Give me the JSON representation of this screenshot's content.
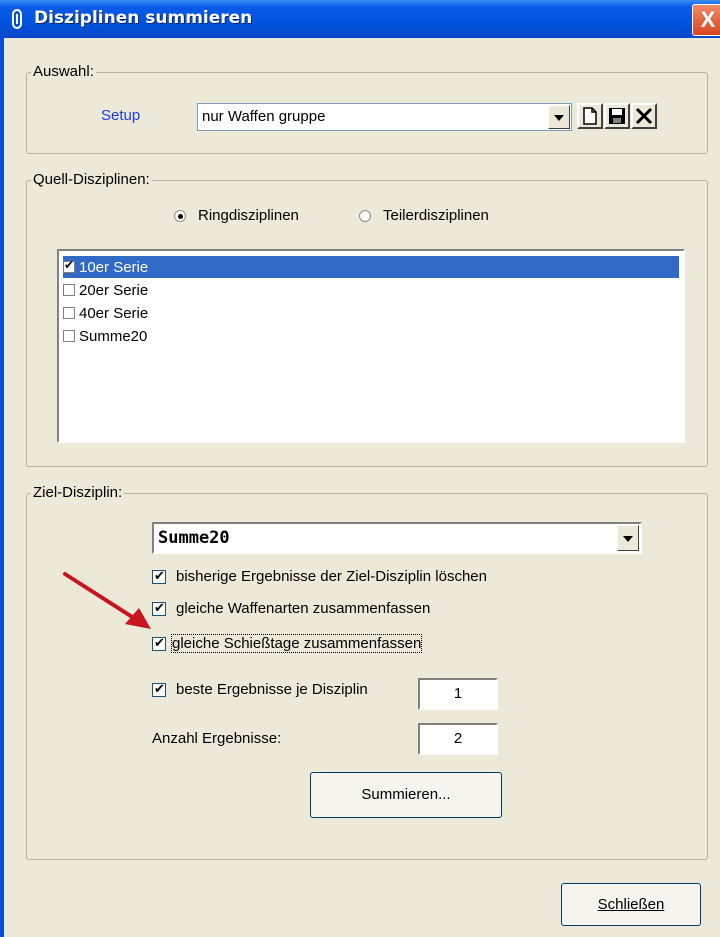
{
  "window": {
    "title": "Disziplinen summieren",
    "close_glyph": "X"
  },
  "auswahl": {
    "legend": "Auswahl:",
    "setup_label": "Setup",
    "setup_value": "nur Waffen gruppe",
    "icons": [
      "new-document-icon",
      "save-disk-icon",
      "delete-x-icon"
    ]
  },
  "quell": {
    "legend": "Quell-Disziplinen:",
    "radio_ring": "Ringdisziplinen",
    "radio_teiler": "Teilerdisziplinen",
    "selected_radio": "Ringdisziplinen",
    "items": [
      {
        "label": "10er Serie",
        "checked": true,
        "selected": true
      },
      {
        "label": "20er Serie",
        "checked": false,
        "selected": false
      },
      {
        "label": "40er Serie",
        "checked": false,
        "selected": false
      },
      {
        "label": "Summe20",
        "checked": false,
        "selected": false
      }
    ]
  },
  "ziel": {
    "legend": "Ziel-Disziplin:",
    "combo_value": "Summe20",
    "opt_delete": "bisherige Ergebnisse der Ziel-Disziplin löschen",
    "opt_weapons": "gleiche Waffenarten zusammenfassen",
    "opt_days": "gleiche Schießtage zusammenfassen",
    "opt_best": "beste Ergebnisse je Disziplin",
    "best_value": "1",
    "count_label": "Anzahl Ergebnisse:",
    "count_value": "2",
    "sum_button": "Summieren..."
  },
  "footer": {
    "close_button": "Schließen"
  },
  "colors": {
    "annotation_arrow": "#c8141e",
    "selection": "#316ac5",
    "titlebar": "#0052de"
  }
}
